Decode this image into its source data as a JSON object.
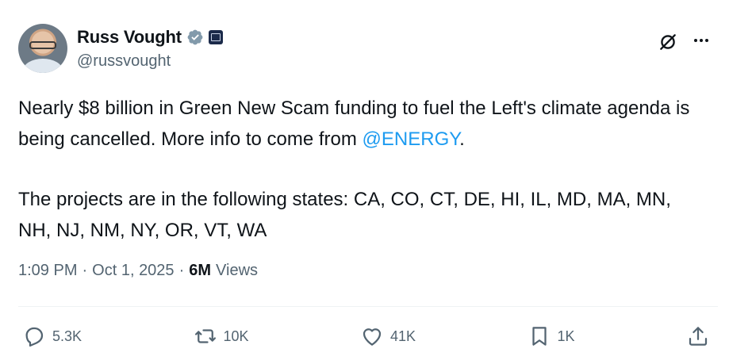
{
  "author": {
    "name": "Russ Vought",
    "handle": "@russvought"
  },
  "tweet": {
    "line1_prefix": "Nearly $8 billion in Green New Scam funding to fuel the Left's climate agenda is being cancelled. More info to come from ",
    "mention": "@ENERGY",
    "line1_suffix": ".",
    "paragraph2": "The projects are in the following states: CA, CO, CT, DE, HI, IL, MD, MA, MN, NH, NJ, NM, NY, OR, VT, WA"
  },
  "meta": {
    "time": "1:09 PM",
    "separator": "·",
    "date": "Oct 1, 2025",
    "views_count": "6M",
    "views_label": "Views"
  },
  "actions": {
    "replies": "5.3K",
    "reposts": "10K",
    "likes": "41K",
    "bookmarks": "1K"
  },
  "colors": {
    "accent": "#1d9bf0",
    "muted": "#536471",
    "text": "#0f1419"
  }
}
